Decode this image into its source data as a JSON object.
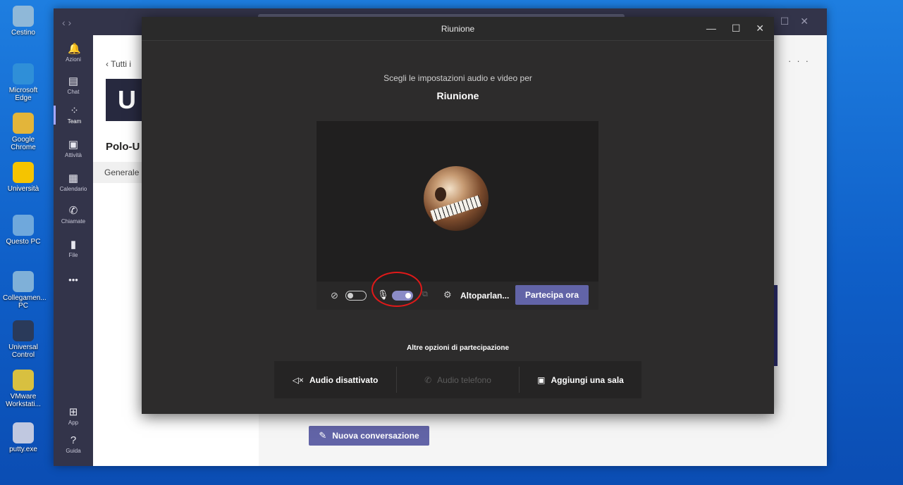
{
  "desktop": {
    "icons": [
      {
        "label": "Cestino",
        "name": "recycle-bin-icon",
        "color": "#8fb8d8"
      },
      {
        "label": "Microsoft Edge",
        "name": "edge-icon",
        "color": "#2f8fd8"
      },
      {
        "label": "Google Chrome",
        "name": "chrome-icon",
        "color": "#e3b53a"
      },
      {
        "label": "Università",
        "name": "warning-folder-icon",
        "color": "#f5c400"
      },
      {
        "label": "Questo PC",
        "name": "pc-icon",
        "color": "#6fa8dc"
      },
      {
        "label": "Collegamen... PC",
        "name": "remote-desktop-icon",
        "color": "#7fb0d8"
      },
      {
        "label": "Universal Control",
        "name": "universal-control-icon",
        "color": "#2a3a5a"
      },
      {
        "label": "VMware Workstati...",
        "name": "vmware-icon",
        "color": "#d8c040"
      },
      {
        "label": "putty.exe",
        "name": "putty-icon",
        "color": "#c0c8e0"
      }
    ]
  },
  "teams": {
    "nav_arrows": "‹ ›",
    "rail": [
      {
        "label": "Azioni",
        "icon": "🔔",
        "name": "rail-actions"
      },
      {
        "label": "Chat",
        "icon": "▤",
        "name": "rail-chat"
      },
      {
        "label": "Team",
        "icon": "⁘",
        "name": "rail-team"
      },
      {
        "label": "Attività",
        "icon": "▣",
        "name": "rail-activity"
      },
      {
        "label": "Calendario",
        "icon": "▦",
        "name": "rail-calendar"
      },
      {
        "label": "Chiamate",
        "icon": "✆",
        "name": "rail-calls"
      },
      {
        "label": "File",
        "icon": "▮",
        "name": "rail-files"
      },
      {
        "label": "•••",
        "icon": "",
        "name": "rail-more"
      },
      {
        "label": "App",
        "icon": "⊞",
        "name": "rail-apps"
      },
      {
        "label": "Guida",
        "icon": "?",
        "name": "rail-help"
      }
    ],
    "back_label": "‹  Tutti i",
    "team_tile": "U",
    "team_name": "Polo-U",
    "channel": "Generale",
    "top_icons": "ⓘ ···",
    "new_conversation": "Nuova conversazione"
  },
  "dialog": {
    "title": "Riunione",
    "controls": {
      "min": "—",
      "max": "☐",
      "close": "✕"
    },
    "subtitle": "Scegli le impostazioni audio e video per",
    "meeting_name": "Riunione",
    "camera_on": false,
    "mic_on": true,
    "speaker_label": "Altoparlan...",
    "join_label": "Partecipa ora",
    "other_options_label": "Altre opzioni di partecipazione",
    "options": [
      {
        "label": "Audio disattivato",
        "icon": "◁×",
        "enabled": true
      },
      {
        "label": "Audio telefono",
        "icon": "✆",
        "enabled": false
      },
      {
        "label": "Aggiungi una sala",
        "icon": "▣",
        "enabled": true
      }
    ],
    "accent": "#6264a7"
  }
}
